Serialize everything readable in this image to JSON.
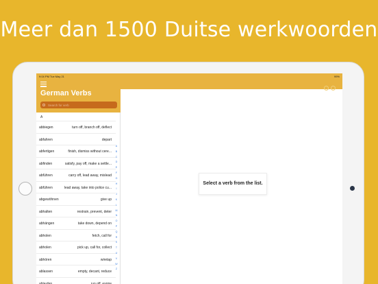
{
  "headline": "Meer dan 1500 Duitse werkwoorden",
  "status": {
    "time": "9:04 PM  Tue May 21",
    "battery": "99%"
  },
  "sidebar": {
    "title": "German Verbs",
    "search_placeholder": "Search for verb",
    "section": "A",
    "verbs": [
      {
        "verb": "abbiegen",
        "translation": "turn off, branch off, deflect"
      },
      {
        "verb": "abfahren",
        "translation": "depart"
      },
      {
        "verb": "abfertigen",
        "translation": "finish, dismiss without cere..."
      },
      {
        "verb": "abfinden",
        "translation": "satisfy, pay off, make a settle..."
      },
      {
        "verb": "abführen",
        "translation": "carry off, lead away, mislead"
      },
      {
        "verb": "abführen",
        "translation": "lead away, take into police cu..."
      },
      {
        "verb": "abgewöhnen",
        "translation": "give up"
      },
      {
        "verb": "abhalten",
        "translation": "restrain, prevent, deter"
      },
      {
        "verb": "abhängen",
        "translation": "take down, depend on"
      },
      {
        "verb": "abholen",
        "translation": "fetch, call for"
      },
      {
        "verb": "abholen",
        "translation": "pick up, call for, collect"
      },
      {
        "verb": "abhören",
        "translation": "wiretap"
      },
      {
        "verb": "ablassen",
        "translation": "empty, decant, reduce"
      },
      {
        "verb": "ablaufen",
        "translation": "run off, expire"
      }
    ],
    "index_letters": [
      "A",
      "B",
      "C",
      "D",
      "E",
      "F",
      "G",
      "H",
      "I",
      "J",
      "K",
      "L",
      "M",
      "N",
      "O",
      "P",
      "Q",
      "R",
      "S",
      "T",
      "U",
      "V",
      "W",
      "Z"
    ]
  },
  "detail": {
    "placeholder": "Select a verb from the list."
  }
}
